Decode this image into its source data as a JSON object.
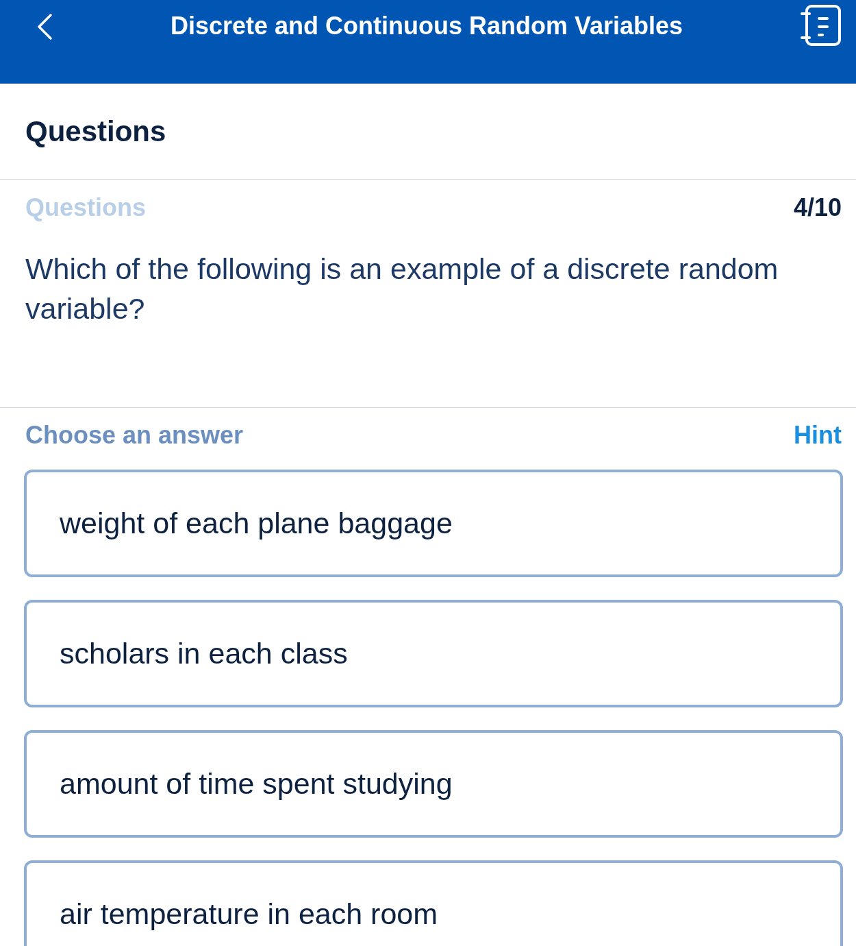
{
  "header": {
    "title": "Discrete and Continuous Random Variables"
  },
  "section_title": "Questions",
  "question": {
    "label": "Questions",
    "progress": "4/10",
    "text": "Which of the following is an example of a discrete random variable?"
  },
  "answers": {
    "label": "Choose an answer",
    "hint": "Hint",
    "options": [
      "weight of each plane baggage",
      "scholars in each class",
      "amount of time spent studying",
      "air temperature in each room"
    ]
  }
}
